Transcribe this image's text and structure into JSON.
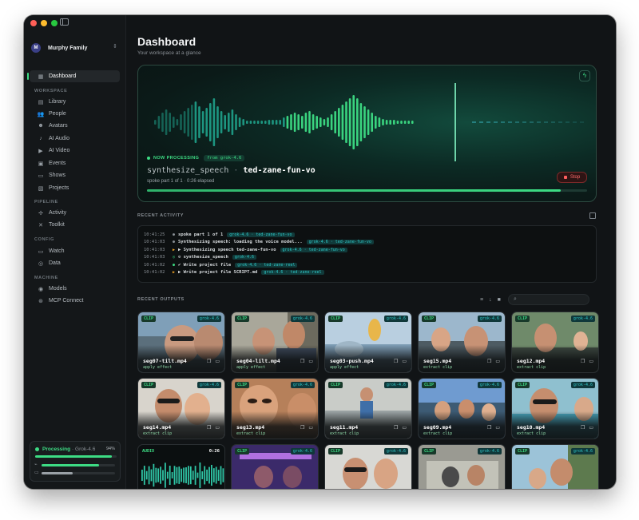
{
  "window": {
    "traffic_colors": [
      "#ff5f57",
      "#febc2e",
      "#28c840"
    ]
  },
  "sidebar": {
    "family": {
      "initial": "M",
      "name": "Murphy Family"
    },
    "dashboard_label": "Dashboard",
    "sections": [
      {
        "title": "WORKSPACE",
        "items": [
          {
            "label": "Library",
            "icon": "library-icon"
          },
          {
            "label": "People",
            "icon": "people-icon"
          },
          {
            "label": "Avatars",
            "icon": "avatars-icon"
          },
          {
            "label": "AI Audio",
            "icon": "audio-icon"
          },
          {
            "label": "AI Video",
            "icon": "video-icon"
          },
          {
            "label": "Events",
            "icon": "events-icon"
          },
          {
            "label": "Shows",
            "icon": "shows-icon"
          },
          {
            "label": "Projects",
            "icon": "projects-icon"
          }
        ]
      },
      {
        "title": "PIPELINE",
        "items": [
          {
            "label": "Activity",
            "icon": "activity-icon"
          },
          {
            "label": "Toolkit",
            "icon": "toolkit-icon"
          }
        ]
      },
      {
        "title": "CONFIG",
        "items": [
          {
            "label": "Watch",
            "icon": "watch-icon"
          },
          {
            "label": "Data",
            "icon": "data-icon"
          }
        ]
      },
      {
        "title": "MACHINE",
        "items": [
          {
            "label": "Models",
            "icon": "models-icon"
          },
          {
            "label": "MCP Connect",
            "icon": "mcp-icon"
          }
        ]
      }
    ],
    "status": {
      "title": "Processing",
      "model": "· Grok-4.6",
      "percent": "94%",
      "progress": 0.94,
      "gpu_level": 0.78,
      "disk_level": 0.42
    }
  },
  "main": {
    "title": "Dashboard",
    "subtitle": "Your workspace at a glance",
    "hero": {
      "status": "NOW PROCESSING",
      "source": "from grok-4.6",
      "task": "synthesize_speech",
      "separator": "·",
      "target": "ted-zane-fun-vo",
      "detail": "spoke part 1 of 1 · 0:26 elapsed",
      "stop_label": "Stop",
      "progress": 0.94
    },
    "activity": {
      "title": "RECENT ACTIVITY",
      "rows": [
        {
          "time": "10:41:25",
          "icon": "dot-icon",
          "msg": "spoke part 1 of 1",
          "tag": "grok-4.6 · ted-zane-fun-vo"
        },
        {
          "time": "10:41:03",
          "icon": "dot-icon",
          "msg": "Synthesizing speech: loading the voice model...",
          "tag": "grok-4.6 · ted-zane-fun-vo"
        },
        {
          "time": "10:41:03",
          "icon": "play-icon",
          "msg": "▶ Synthesizing speech ted-zane-fun-vo",
          "tag": "grok-4.6 · ted-zane-fun-vo"
        },
        {
          "time": "10:41:03",
          "icon": "bot-icon",
          "msg": "⚙ synthesize_speech",
          "tag": "grok-4.6"
        },
        {
          "time": "10:41:02",
          "icon": "check-icon",
          "msg": "✔ Write project file",
          "tag": "grok-4.6 · ted-zane-reel"
        },
        {
          "time": "10:41:02",
          "icon": "play-icon",
          "msg": "▶ Write project file SCRIPT.md",
          "tag": "grok-4.6 · ted-zane-reel"
        }
      ]
    },
    "outputs": {
      "title": "RECENT OUTPUTS",
      "search_placeholder": "",
      "clip_label": "CLIP",
      "model_label": "grok-4.6",
      "audio_label": "AUDIO",
      "audio_time": "0:26",
      "cards": [
        {
          "name": "seg07-tilt.mp4",
          "action": "apply effect"
        },
        {
          "name": "seg04-lilt.mp4",
          "action": "apply effect"
        },
        {
          "name": "seg03-push.mp4",
          "action": "apply effect"
        },
        {
          "name": "seg15.mp4",
          "action": "extract clip"
        },
        {
          "name": "seg12.mp4",
          "action": "extract clip"
        },
        {
          "name": "seg14.mp4",
          "action": "extract clip"
        },
        {
          "name": "seg13.mp4",
          "action": "extract clip"
        },
        {
          "name": "seg11.mp4",
          "action": "extract clip"
        },
        {
          "name": "seg09.mp4",
          "action": "extract clip"
        },
        {
          "name": "seg10.mp4",
          "action": "extract clip"
        }
      ]
    }
  },
  "colors": {
    "accent": "#3ddc84",
    "teal": "#2fc6c6",
    "danger": "#ff5e5e",
    "background": "#111416"
  }
}
